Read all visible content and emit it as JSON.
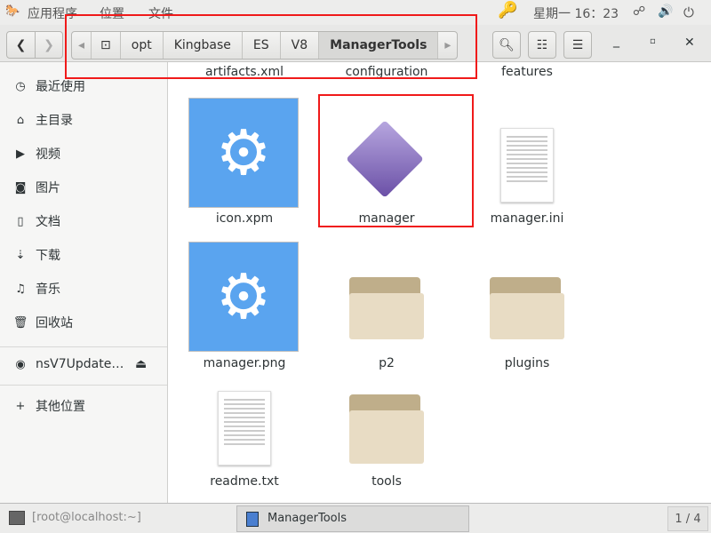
{
  "topbar": {
    "apps": "应用程序",
    "places": "位置",
    "files": "文件",
    "clock": "星期一 16：23"
  },
  "pathbar": {
    "crumbs": [
      "opt",
      "Kingbase",
      "ES",
      "V8",
      "ManagerTools"
    ]
  },
  "sidebar": {
    "items": [
      "最近使用",
      "主目录",
      "视频",
      "图片",
      "文档",
      "下载",
      "音乐",
      "回收站"
    ],
    "device": "nsV7Update…",
    "other": "其他位置"
  },
  "files": {
    "row0": [
      "artifacts.xml",
      "configuration",
      "features"
    ],
    "icon_xpm": "icon.xpm",
    "manager": "manager",
    "manager_ini": "manager.ini",
    "manager_png": "manager.png",
    "p2": "p2",
    "plugins": "plugins",
    "readme": "readme.txt",
    "tools": "tools"
  },
  "taskbar": {
    "terminal": "[root@localhost:~]",
    "window": "ManagerTools",
    "workspace": "1 / 4"
  },
  "colors": {
    "highlight": "#f01a1a",
    "icon_blue": "#5aa4ef"
  }
}
